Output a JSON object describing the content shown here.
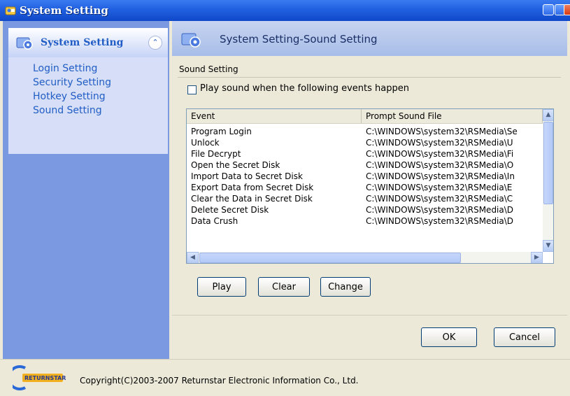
{
  "window": {
    "title": "System Setting"
  },
  "sidebar": {
    "title": "System Setting",
    "items": [
      {
        "label": "Login Setting"
      },
      {
        "label": "Security Setting"
      },
      {
        "label": "Hotkey Setting"
      },
      {
        "label": "Sound Setting"
      }
    ]
  },
  "header": {
    "title": "System Setting-Sound Setting"
  },
  "sound": {
    "group_label": "Sound Setting",
    "checkbox_label": "Play sound when the following events happen",
    "checked": false,
    "columns": [
      "Event",
      "Prompt Sound File"
    ],
    "rows": [
      {
        "event": "Program Login",
        "file": "C:\\WINDOWS\\system32\\RSMedia\\Se"
      },
      {
        "event": "Unlock",
        "file": "C:\\WINDOWS\\system32\\RSMedia\\U"
      },
      {
        "event": "File Decrypt",
        "file": "C:\\WINDOWS\\system32\\RSMedia\\Fi"
      },
      {
        "event": "Open the Secret Disk",
        "file": "C:\\WINDOWS\\system32\\RSMedia\\O"
      },
      {
        "event": "Import Data to Secret Disk",
        "file": "C:\\WINDOWS\\system32\\RSMedia\\In"
      },
      {
        "event": "Export Data from Secret Disk",
        "file": "C:\\WINDOWS\\system32\\RSMedia\\E"
      },
      {
        "event": "Clear the Data in Secret Disk",
        "file": "C:\\WINDOWS\\system32\\RSMedia\\C"
      },
      {
        "event": "Delete Secret Disk",
        "file": "C:\\WINDOWS\\system32\\RSMedia\\D"
      },
      {
        "event": "Data Crush",
        "file": "C:\\WINDOWS\\system32\\RSMedia\\D"
      }
    ],
    "buttons": {
      "play": "Play",
      "clear": "Clear",
      "change": "Change"
    }
  },
  "dialog": {
    "ok": "OK",
    "cancel": "Cancel"
  },
  "footer": {
    "logo_text": "RETURNSTAR",
    "copyright": "Copyright(C)2003-2007 Returnstar Electronic Information Co., Ltd."
  },
  "colors": {
    "titlebar": "#2060e0",
    "sidebar": "#7a99e1",
    "link": "#215dc6"
  }
}
